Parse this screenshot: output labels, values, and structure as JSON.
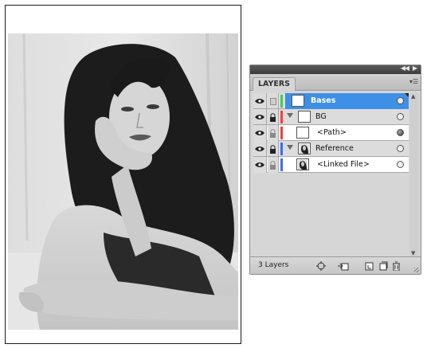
{
  "panel": {
    "tab_label": "LAYERS",
    "footer_count": "3 Layers"
  },
  "layers": [
    {
      "name": "Bases",
      "color": "#38d24a",
      "selected": true
    },
    {
      "name": "BG",
      "color": "#ff3b3b"
    },
    {
      "name": "<Path>",
      "color": "#ff3b3b",
      "sublayer": true
    },
    {
      "name": "Reference",
      "color": "#3b6cff"
    },
    {
      "name": "<Linked File>",
      "color": "#3b6cff",
      "sublayer": true
    }
  ],
  "icons": {
    "eye": "eye-icon",
    "lock": "lock-icon",
    "disclosure": "disclosure-triangle-icon",
    "target": "target-circle-icon",
    "panel_menu": "panel-menu-icon",
    "collapse": "collapse-panel-icon",
    "locate": "locate-object-icon",
    "make_clip": "make-clipping-mask-icon",
    "new_sublayer": "new-sublayer-icon",
    "new_layer": "new-layer-icon",
    "delete": "trash-icon"
  },
  "colors": {
    "selection": "#3e8fe6",
    "panel_bg": "#d6d6d6"
  }
}
